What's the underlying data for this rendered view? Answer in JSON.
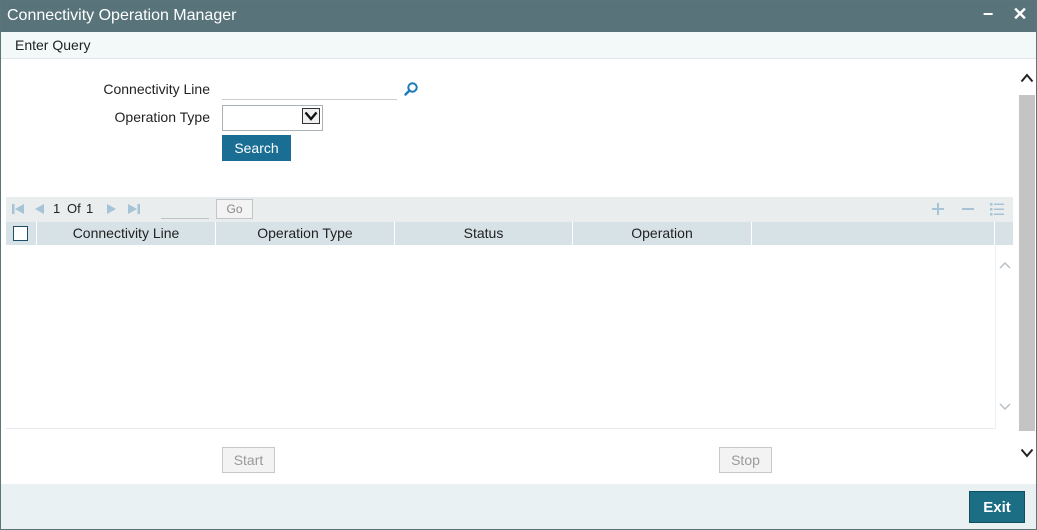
{
  "window": {
    "title": "Connectivity Operation Manager",
    "minimize_glyph": "−",
    "close_glyph": "✕"
  },
  "menu": {
    "enter_query": "Enter Query"
  },
  "form": {
    "connectivity_line_label": "Connectivity Line",
    "connectivity_line_value": "",
    "operation_type_label": "Operation Type",
    "operation_type_selected": "",
    "search_button": "Search"
  },
  "grid": {
    "pager": {
      "current": "1",
      "of_label": "Of",
      "total": "1",
      "go_label": "Go"
    },
    "columns": [
      "Connectivity Line",
      "Operation Type",
      "Status",
      "Operation"
    ],
    "rows": []
  },
  "actions": {
    "start": "Start",
    "stop": "Stop",
    "exit": "Exit"
  },
  "icons": {
    "lookup": "search-icon",
    "first": "first-page-icon",
    "prev": "previous-page-icon",
    "next": "next-page-icon",
    "last": "last-page-icon",
    "add": "add-row-icon",
    "remove": "remove-row-icon",
    "columns": "column-settings-icon"
  },
  "colors": {
    "titlebar": "#58737a",
    "primary_button": "#1b6e93",
    "grid_header": "#d6e2e6",
    "footer": "#e9f1f2"
  }
}
